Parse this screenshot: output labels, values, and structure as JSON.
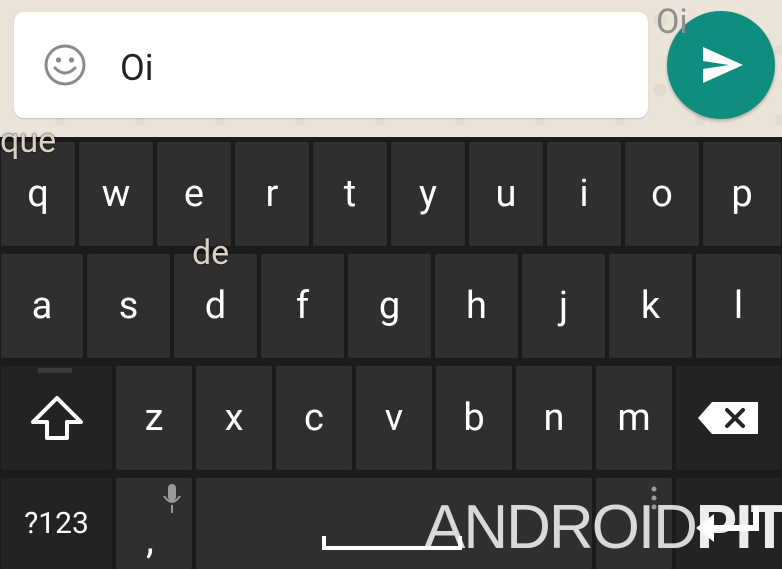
{
  "compose": {
    "message": "Oi",
    "suggestion": "Oi"
  },
  "keyboard": {
    "row1": [
      "q",
      "w",
      "e",
      "r",
      "t",
      "y",
      "u",
      "i",
      "o",
      "p"
    ],
    "row2": [
      "a",
      "s",
      "d",
      "f",
      "g",
      "h",
      "j",
      "k",
      "l"
    ],
    "row3": [
      "z",
      "x",
      "c",
      "v",
      "b",
      "n",
      "m"
    ],
    "symbols_label": "?123",
    "comma_label": ",",
    "hints": {
      "que": "que",
      "de": "de"
    }
  },
  "watermark": {
    "part1": "ANDROID",
    "part2": "PIT"
  },
  "colors": {
    "send": "#0f8d7e",
    "key": "#2f2f2f",
    "keyboard_bg": "#1b1b1b"
  }
}
